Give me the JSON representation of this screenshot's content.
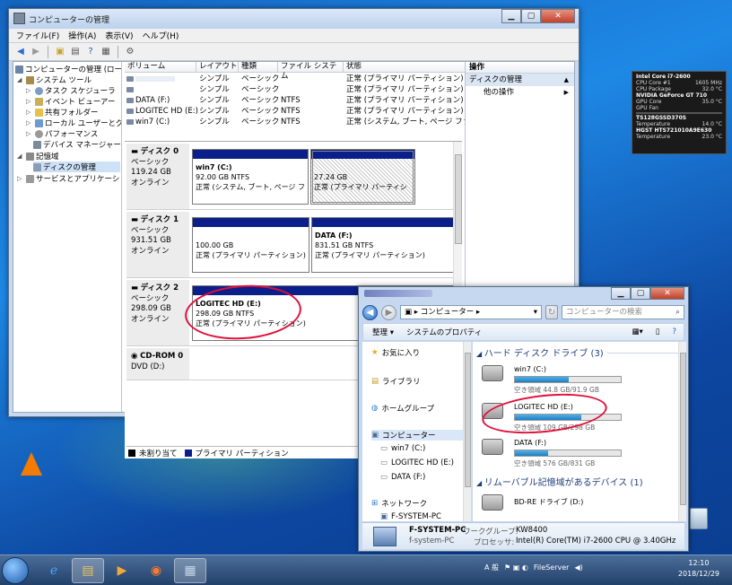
{
  "computer_management": {
    "title": "コンピューターの管理",
    "menu": [
      "ファイル(F)",
      "操作(A)",
      "表示(V)",
      "ヘルプ(H)"
    ],
    "tree": [
      {
        "label": "コンピューターの管理 (ローカル",
        "level": 0
      },
      {
        "label": "システム ツール",
        "level": 1
      },
      {
        "label": "タスク スケジューラ",
        "level": 2
      },
      {
        "label": "イベント ビューアー",
        "level": 2
      },
      {
        "label": "共有フォルダー",
        "level": 2
      },
      {
        "label": "ローカル ユーザーとグ",
        "level": 2
      },
      {
        "label": "パフォーマンス",
        "level": 2
      },
      {
        "label": "デバイス マネージャー",
        "level": 2
      },
      {
        "label": "記憶域",
        "level": 1
      },
      {
        "label": "ディスクの管理",
        "level": 2
      },
      {
        "label": "サービスとアプリケーショ",
        "level": 1
      }
    ],
    "volume_headers": [
      "ボリューム",
      "レイアウト",
      "種類",
      "ファイル システム",
      "状態"
    ],
    "volumes": [
      {
        "name": "",
        "layout": "シンプル",
        "type": "ベーシック",
        "fs": "",
        "status": "正常 (プライマリ パーティション)"
      },
      {
        "name": "",
        "layout": "シンプル",
        "type": "ベーシック",
        "fs": "",
        "status": "正常 (プライマリ パーティション)"
      },
      {
        "name": "DATA (F:)",
        "layout": "シンプル",
        "type": "ベーシック",
        "fs": "NTFS",
        "status": "正常 (プライマリ パーティション)"
      },
      {
        "name": "LOGITEC HD (E:)",
        "layout": "シンプル",
        "type": "ベーシック",
        "fs": "NTFS",
        "status": "正常 (プライマリ パーティション)"
      },
      {
        "name": "win7 (C:)",
        "layout": "シンプル",
        "type": "ベーシック",
        "fs": "NTFS",
        "status": "正常 (システム, ブート, ページ ファイ"
      }
    ],
    "disks": [
      {
        "name": "ディスク 0",
        "type": "ベーシック",
        "size": "119.24 GB",
        "state": "オンライン",
        "parts": [
          {
            "label": "win7  (C:)",
            "size": "92.00 GB NTFS",
            "status": "正常 (システム, ブート, ページ ファ"
          },
          {
            "label": "",
            "size": "27.24 GB",
            "status": "正常 (プライマリ パーティシ"
          }
        ]
      },
      {
        "name": "ディスク 1",
        "type": "ベーシック",
        "size": "931.51 GB",
        "state": "オンライン",
        "parts": [
          {
            "label": "",
            "size": "100.00 GB",
            "status": "正常 (プライマリ パーティション)"
          },
          {
            "label": "DATA  (F:)",
            "size": "831.51 GB NTFS",
            "status": "正常 (プライマリ パーティション)"
          }
        ]
      },
      {
        "name": "ディスク 2",
        "type": "ベーシック",
        "size": "298.09 GB",
        "state": "オンライン",
        "parts": [
          {
            "label": "LOGITEC HD  (E:)",
            "size": "298.09 GB NTFS",
            "status": "正常 (プライマリ パーティション)"
          }
        ]
      },
      {
        "name": "CD-ROM 0",
        "type": "DVD (D:)",
        "size": "",
        "state": "",
        "parts": []
      }
    ],
    "legend": {
      "unallocated": "未割り当て",
      "primary": "プライマリ パーティション"
    },
    "actions": {
      "header": "操作",
      "sub": "ディスクの管理",
      "item": "他の操作"
    }
  },
  "explorer": {
    "address": "コンピューター",
    "search_placeholder": "コンピューターの検索",
    "commands": [
      "整理 ▾",
      "システムのプロパティ"
    ],
    "nav": [
      {
        "label": "お気に入り",
        "icon": "star-icon"
      },
      {
        "label": "ライブラリ",
        "icon": "library-icon"
      },
      {
        "label": "ホームグループ",
        "icon": "homegroup-icon"
      },
      {
        "label": "コンピューター",
        "icon": "computer-icon"
      },
      {
        "label": "win7 (C:)",
        "icon": "drive-icon"
      },
      {
        "label": "LOGITEC HD (E:)",
        "icon": "drive-icon"
      },
      {
        "label": "DATA (F:)",
        "icon": "drive-icon"
      },
      {
        "label": "ネットワーク",
        "icon": "network-icon"
      },
      {
        "label": "F-SYSTEM-PC",
        "icon": "computer-icon"
      }
    ],
    "groups": {
      "hdd": "ハード ディスク ドライブ (3)",
      "removable": "リムーバブル記憶域があるデバイス (1)"
    },
    "drives": [
      {
        "name": "win7 (C:)",
        "free": "空き領域 44.8 GB/91.9 GB",
        "used_fraction": 0.51
      },
      {
        "name": "LOGITEC HD (E:)",
        "free": "空き領域 109 GB/298 GB",
        "used_fraction": 0.63
      },
      {
        "name": "DATA (F:)",
        "free": "空き領域 576 GB/831 GB",
        "used_fraction": 0.31
      }
    ],
    "bd_drive": "BD-RE ドライブ (D:)",
    "details": {
      "pc_name": "F-SYSTEM-PC",
      "pc_sub": "f-system-PC",
      "wg_label": "ワークグループ:",
      "wg": "KW8400",
      "cpu_label": "プロセッサ:",
      "cpu": "Intel(R) Core(TM) i7-2600 CPU @ 3.40GHz"
    }
  },
  "gadget": {
    "cpu": "Intel Core i7-2600",
    "rows": [
      [
        "CPU Core #1",
        "1605 MHz"
      ],
      [
        "CPU Package",
        "32.0 °C"
      ],
      [
        "NVIDIA GeForce GT 710",
        ""
      ],
      [
        "GPU Core",
        "35.0 °C"
      ],
      [
        "GPU Fan",
        ""
      ],
      [
        "TS128GSSD370S",
        ""
      ],
      [
        "Temperature",
        "14.0 °C"
      ],
      [
        "HGST HTS721010A9E630",
        ""
      ],
      [
        "Temperature",
        "23.0 °C"
      ]
    ]
  },
  "taskbar": {
    "time": "12:10",
    "date": "2018/12/29",
    "tray_label": "FileServer",
    "ime": "A 般"
  }
}
